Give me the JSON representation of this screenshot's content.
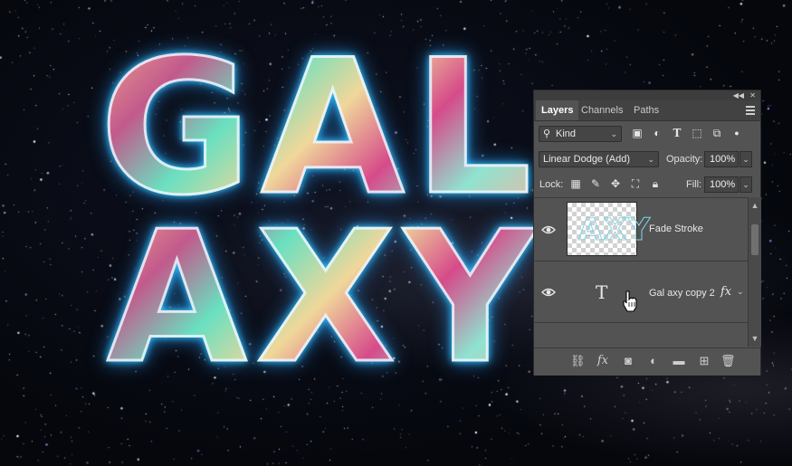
{
  "canvas": {
    "line1": "GAL",
    "line2": "AXY"
  },
  "panel": {
    "tabs": [
      {
        "label": "Layers",
        "active": true
      },
      {
        "label": "Channels",
        "active": false
      },
      {
        "label": "Paths",
        "active": false
      }
    ],
    "filter": {
      "selected": "Kind"
    },
    "blend_mode": "Linear Dodge (Add)",
    "opacity_label": "Opacity:",
    "opacity_value": "100%",
    "lock_label": "Lock:",
    "fill_label": "Fill:",
    "fill_value": "100%",
    "layers": [
      {
        "name": "Fade Stroke",
        "visible": true,
        "type": "raster"
      },
      {
        "name": "Gal axy copy 2",
        "visible": true,
        "type": "text",
        "has_effects": true
      }
    ]
  },
  "colors": {
    "panel_bg": "#535353",
    "glow": "#2ec8ff"
  }
}
